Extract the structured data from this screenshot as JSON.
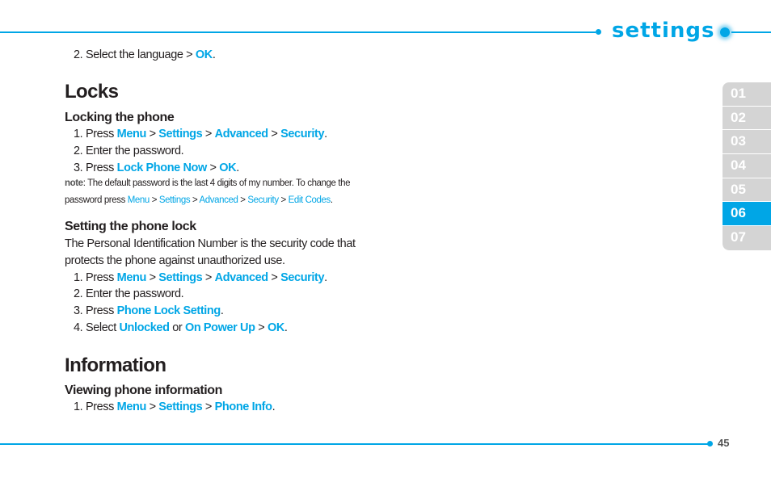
{
  "header": {
    "title": "settings"
  },
  "chapters": [
    {
      "label": "01",
      "active": false
    },
    {
      "label": "02",
      "active": false
    },
    {
      "label": "03",
      "active": false
    },
    {
      "label": "04",
      "active": false
    },
    {
      "label": "05",
      "active": false
    },
    {
      "label": "06",
      "active": true
    },
    {
      "label": "07",
      "active": false
    }
  ],
  "intro_step": {
    "num": "2.",
    "text": "Select the language",
    "sep": ">",
    "link": "OK",
    "end": "."
  },
  "locks": {
    "title": "Locks",
    "locking": {
      "title": "Locking the phone",
      "step1": {
        "num": "1.",
        "text": "Press",
        "l1": "Menu",
        "l2": "Settings",
        "l3": "Advanced",
        "l4": "Security"
      },
      "step2": {
        "num": "2.",
        "text": "Enter the password."
      },
      "step3": {
        "num": "3.",
        "text": "Press",
        "l1": "Lock Phone Now",
        "l2": "OK"
      },
      "note": {
        "label": "note",
        "line1": ": The default password is the last 4 digits of my number. To change the",
        "line2_prefix": "password press",
        "l1": "Menu",
        "l2": "Settings",
        "l3": "Advanced",
        "l4": "Security",
        "l5": "Edit Codes"
      }
    },
    "setting": {
      "title": "Setting the phone lock",
      "desc1": "The Personal Identification Number is the security code that",
      "desc2": "protects the phone against unauthorized use.",
      "step1": {
        "num": "1.",
        "text": "Press",
        "l1": "Menu",
        "l2": "Settings",
        "l3": "Advanced",
        "l4": "Security"
      },
      "step2": {
        "num": "2.",
        "text": "Enter the password."
      },
      "step3": {
        "num": "3.",
        "text": "Press",
        "l1": "Phone Lock Setting"
      },
      "step4": {
        "num": "4.",
        "text": "Select",
        "l1": "Unlocked",
        "or": "or",
        "l2": "On Power Up",
        "l3": "OK"
      }
    }
  },
  "information": {
    "title": "Information",
    "viewing": {
      "title": "Viewing phone information",
      "step1": {
        "num": "1.",
        "text": "Press",
        "l1": "Menu",
        "l2": "Settings",
        "l3": "Phone Info"
      }
    }
  },
  "sep": ">",
  "footer": {
    "page_number": "45"
  },
  "colors": {
    "accent": "#00a6e6",
    "tab_inactive": "#d4d4d4",
    "text": "#231f20"
  }
}
